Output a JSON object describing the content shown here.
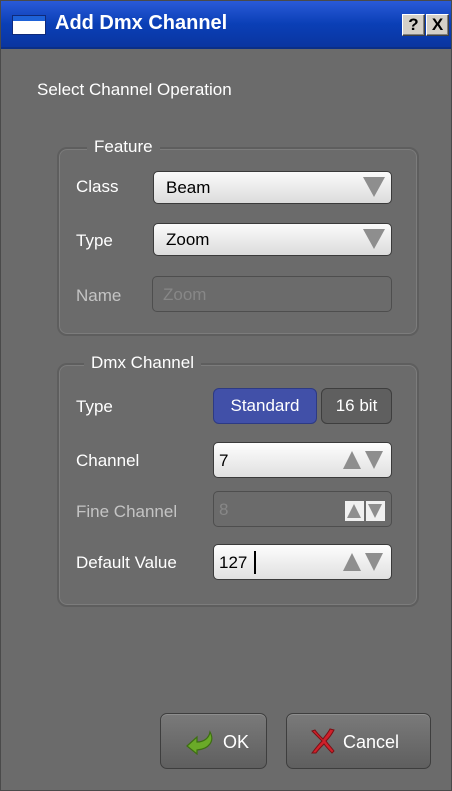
{
  "window": {
    "title": "Add Dmx Channel",
    "help_button": "?",
    "close_button": "X"
  },
  "operation_label": "Select Channel Operation",
  "feature": {
    "legend": "Feature",
    "class_label": "Class",
    "class_value": "Beam",
    "type_label": "Type",
    "type_value": "Zoom",
    "name_label": "Name",
    "name_placeholder": "Zoom"
  },
  "dmx": {
    "legend": "Dmx Channel",
    "type_label": "Type",
    "type_options": [
      "Standard",
      "16 bit"
    ],
    "type_selected": "Standard",
    "channel_label": "Channel",
    "channel_value": "7",
    "fine_channel_label": "Fine Channel",
    "fine_channel_value": "8",
    "default_value_label": "Default Value",
    "default_value": "127"
  },
  "buttons": {
    "ok": "OK",
    "cancel": "Cancel"
  },
  "colors": {
    "titlebar": "#0a3fb6",
    "panel": "#6b6b6b",
    "selected_toggle": "#4150a8",
    "ok_icon": "#6aaa28",
    "cancel_icon": "#d0202a"
  },
  "icons": {
    "window": "window-icon",
    "ok": "green-check-arrow-icon",
    "cancel": "red-x-icon"
  }
}
